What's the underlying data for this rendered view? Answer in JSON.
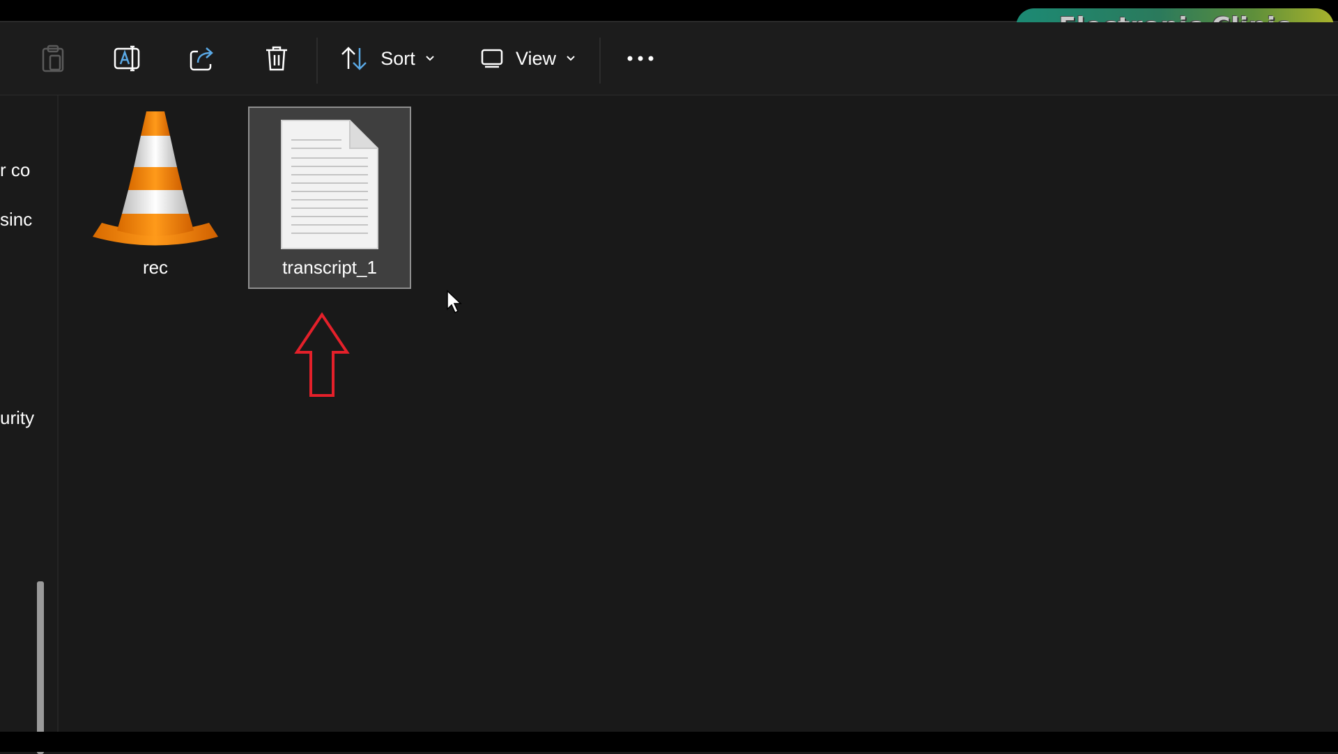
{
  "toolbar": {
    "sort_label": "Sort",
    "view_label": "View",
    "icons": [
      "paste-icon",
      "rename-icon",
      "share-icon",
      "delete-icon",
      "sort-icon",
      "view-icon",
      "more-icon"
    ]
  },
  "watermark": {
    "text": "Electronic Clinic"
  },
  "nav": {
    "items": [
      {
        "label": "r co"
      },
      {
        "label": "sinc"
      },
      {
        "label": "urity"
      }
    ]
  },
  "files": [
    {
      "name": "rec",
      "icon": "vlc-cone-icon",
      "selected": false
    },
    {
      "name": "transcript_1",
      "icon": "text-document-icon",
      "selected": true
    }
  ],
  "colors": {
    "background": "#191919",
    "selection": "#3f3f3f",
    "accent_arrow": "#e4202a",
    "vlc_orange": "#f28c0f"
  }
}
